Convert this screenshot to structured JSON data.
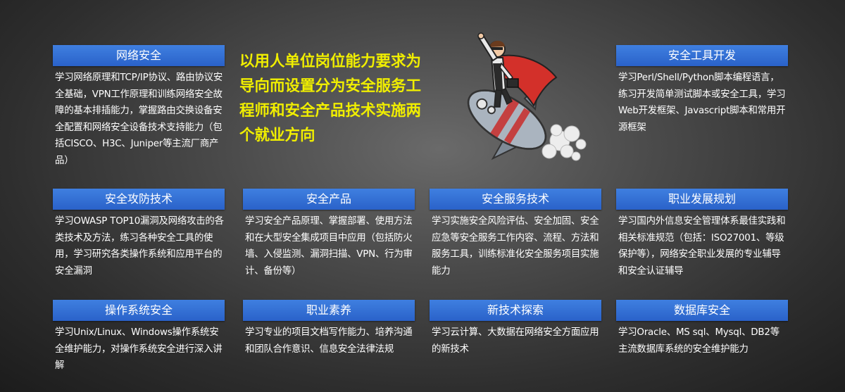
{
  "tagline": "以用人单位岗位能力要求为导向而设置分为安全服务工程师和安全产品技术实施两个就业方向",
  "colors": {
    "card_title_bg": "#2f6fd8",
    "tagline_text": "#f0ee00",
    "background": "#3a3a3a"
  },
  "cards": {
    "network": {
      "title": "网络安全",
      "desc": "学习网络原理和TCP/IP协议、路由协议安全基础，VPN工作原理和训练网络安全故障的基本排插能力，掌握路由交换设备安全配置和网络安全设备技术支持能力（包括CISCO、H3C、Juniper等主流厂商产品）"
    },
    "tools": {
      "title": "安全工具开发",
      "desc": "学习Perl/Shell/Python脚本编程语言，练习开发简单测试脚本或安全工具，学习Web开发框架、Javascript脚本和常用开源框架"
    },
    "attack": {
      "title": "安全攻防技术",
      "desc": "学习OWASP TOP10漏洞及网络攻击的各类技术及方法，练习各种安全工具的使用，学习研究各类操作系统和应用平台的安全漏洞"
    },
    "product": {
      "title": "安全产品",
      "desc": "学习安全产品原理、掌握部署、使用方法和在大型安全集成项目中应用（包括防火墙、入侵监测、漏洞扫描、VPN、行为审计、备份等）"
    },
    "service": {
      "title": "安全服务技术",
      "desc": "学习实施安全风险评估、安全加固、安全应急等安全服务工作内容、流程、方法和服务工具，训练标准化安全服务项目实施能力"
    },
    "career": {
      "title": "职业发展规划",
      "desc": "学习国内外信息安全管理体系最佳实践和相关标准规范（包括：ISO27001、等级保护等），网络安全职业发展的专业辅导和安全认证辅导"
    },
    "os": {
      "title": "操作系统安全",
      "desc": "学习Unix/Linux、Windows操作系统安全维护能力，对操作系统安全进行深入讲解"
    },
    "quality": {
      "title": "职业素养",
      "desc": "学习专业的项目文档写作能力、培养沟通和团队合作意识、信息安全法律法规"
    },
    "newtech": {
      "title": "新技术探索",
      "desc": "学习云计算、大数据在网络安全方面应用的新技术"
    },
    "database": {
      "title": "数据库安全",
      "desc": "学习Oracle、MS sql、Mysql、DB2等主流数据库系统的安全维护能力"
    }
  }
}
